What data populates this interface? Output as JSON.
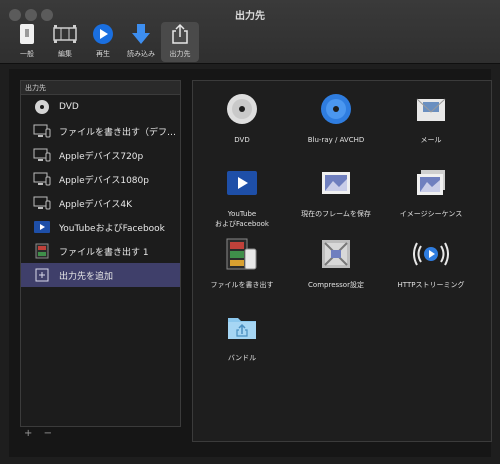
{
  "window": {
    "title": "出力先"
  },
  "toolbar": {
    "general_label": "一般",
    "edit_label": "編集",
    "play_label": "再生",
    "import_label": "読み込み",
    "share_label": "出力先"
  },
  "sidebar": {
    "header": "出力先",
    "items": [
      {
        "label": "DVD",
        "icon": "dvd-disc-icon"
      },
      {
        "label": "ファイルを書き出す（デフ…",
        "icon": "devices-icon"
      },
      {
        "label": "Appleデバイス720p",
        "icon": "devices-icon"
      },
      {
        "label": "Appleデバイス1080p",
        "icon": "devices-icon"
      },
      {
        "label": "Appleデバイス4K",
        "icon": "devices-icon"
      },
      {
        "label": "YouTubeおよびFacebook",
        "icon": "video-play-icon"
      },
      {
        "label": "ファイルを書き出す 1",
        "icon": "film-icon"
      },
      {
        "label": "出力先を追加",
        "icon": "add-destination-icon",
        "selected": true
      }
    ],
    "footer": {
      "add": "+",
      "remove": "−"
    }
  },
  "destinations": {
    "dvd": "DVD",
    "bluray": "Blu-ray / AVCHD",
    "mail": "メール",
    "youtube_line1": "YouTube",
    "youtube_line2": "およびFacebook",
    "save_frame": "現在のフレームを保存",
    "image_sequence": "イメージシーケンス",
    "export_file": "ファイルを書き出す",
    "compressor": "Compressor設定",
    "http_streaming": "HTTPストリーミング",
    "bundle": "バンドル"
  },
  "colors": {
    "accent": "#3f3f6a",
    "play_blue": "#1a6fe0"
  }
}
